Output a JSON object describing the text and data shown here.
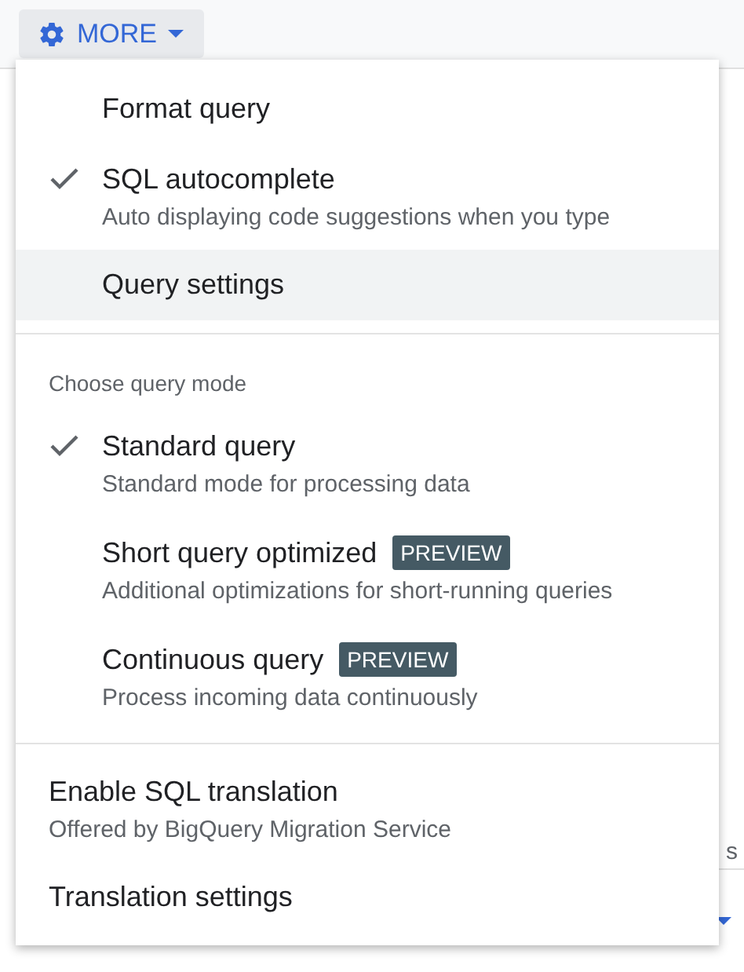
{
  "button": {
    "label": "MORE"
  },
  "background_fragment": "s",
  "menu": {
    "sections": [
      {
        "items": [
          {
            "kind": "checkable",
            "label": "Format query",
            "checked": false,
            "highlighted": false
          },
          {
            "kind": "checkable",
            "label": "SQL autocomplete",
            "description": "Auto displaying code suggestions when you type",
            "checked": true,
            "highlighted": false
          },
          {
            "kind": "checkable",
            "label": "Query settings",
            "checked": false,
            "highlighted": true
          }
        ]
      },
      {
        "header": "Choose query mode",
        "items": [
          {
            "kind": "checkable",
            "label": "Standard query",
            "description": "Standard mode for processing data",
            "checked": true,
            "highlighted": false
          },
          {
            "kind": "checkable",
            "label": "Short query optimized",
            "badge": "PREVIEW",
            "description": "Additional optimizations for short-running queries",
            "checked": false,
            "highlighted": false
          },
          {
            "kind": "checkable",
            "label": "Continuous query",
            "badge": "PREVIEW",
            "description": "Process incoming data continuously",
            "checked": false,
            "highlighted": false
          }
        ]
      },
      {
        "items": [
          {
            "kind": "plain",
            "label": "Enable SQL translation",
            "description": "Offered by BigQuery Migration Service",
            "highlighted": false
          },
          {
            "kind": "plain",
            "label": "Translation settings",
            "highlighted": false
          }
        ]
      }
    ]
  }
}
